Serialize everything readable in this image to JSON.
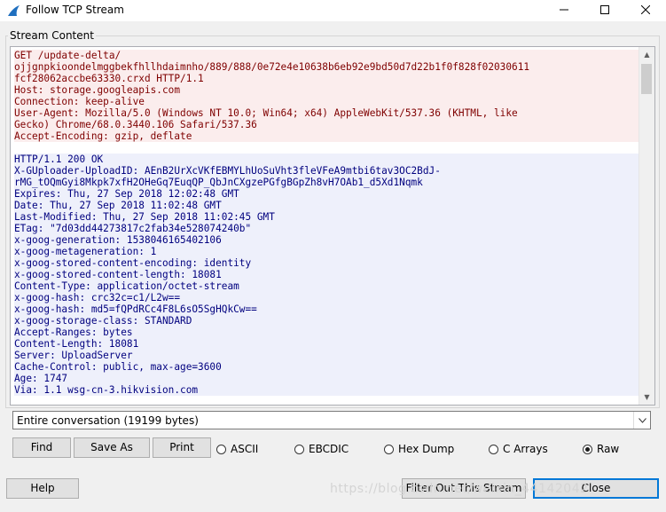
{
  "window": {
    "title": "Follow TCP Stream",
    "minimize_glyph": "—",
    "maximize_glyph": "☐",
    "close_glyph": "✕"
  },
  "stream_group": {
    "label": "Stream Content"
  },
  "request_lines": [
    "GET /update-delta/",
    "ojjgnpkioondelmggbekfhllhdaimnho/889/888/0e72e4e10638b6eb92e9bd50d7d22b1f0f828f02030611",
    "fcf28062accbe63330.crxd HTTP/1.1",
    "Host: storage.googleapis.com",
    "Connection: keep-alive",
    "User-Agent: Mozilla/5.0 (Windows NT 10.0; Win64; x64) AppleWebKit/537.36 (KHTML, like",
    "Gecko) Chrome/68.0.3440.106 Safari/537.36",
    "Accept-Encoding: gzip, deflate"
  ],
  "response_lines": [
    "HTTP/1.1 200 OK",
    "X-GUploader-UploadID: AEnB2UrXcVKfEBMYLhUoSuVht3fleVFeA9mtbi6tav3OC2BdJ-",
    "rMG_tOQmGyi8Mkpk7xfH2OHeGq7EuqQP_QbJnCXgzePGfgBGpZh8vH7OAb1_d5Xd1Nqmk",
    "Expires: Thu, 27 Sep 2018 12:02:48 GMT",
    "Date: Thu, 27 Sep 2018 11:02:48 GMT",
    "Last-Modified: Thu, 27 Sep 2018 11:02:45 GMT",
    "ETag: \"7d03dd44273817c2fab34e528074240b\"",
    "x-goog-generation: 1538046165402106",
    "x-goog-metageneration: 1",
    "x-goog-stored-content-encoding: identity",
    "x-goog-stored-content-length: 18081",
    "Content-Type: application/octet-stream",
    "x-goog-hash: crc32c=c1/L2w==",
    "x-goog-hash: md5=fQPdRCc4F8L6sO5SgHQkCw==",
    "x-goog-storage-class: STANDARD",
    "Accept-Ranges: bytes",
    "Content-Length: 18081",
    "Server: UploadServer",
    "Cache-Control: public, max-age=3600",
    "Age: 1747",
    "Via: 1.1 wsg-cn-3.hikvision.com"
  ],
  "conversation_select": {
    "value": "Entire conversation (19199 bytes)"
  },
  "buttons": {
    "find": "Find",
    "save_as": "Save As",
    "print": "Print",
    "help": "Help",
    "filter_out": "Filter Out This Stream",
    "close": "Close"
  },
  "formats": [
    {
      "label": "ASCII",
      "selected": false
    },
    {
      "label": "EBCDIC",
      "selected": false
    },
    {
      "label": "Hex Dump",
      "selected": false
    },
    {
      "label": "C Arrays",
      "selected": false
    },
    {
      "label": "Raw",
      "selected": true
    }
  ],
  "watermark": "https://blog.csdn.net/weixin_44142042",
  "colors": {
    "request_text": "#7f0000",
    "request_bg": "#fbeded",
    "response_text": "#00007f",
    "response_bg": "#eef0fb",
    "title_icon": "#1f6fbf"
  }
}
